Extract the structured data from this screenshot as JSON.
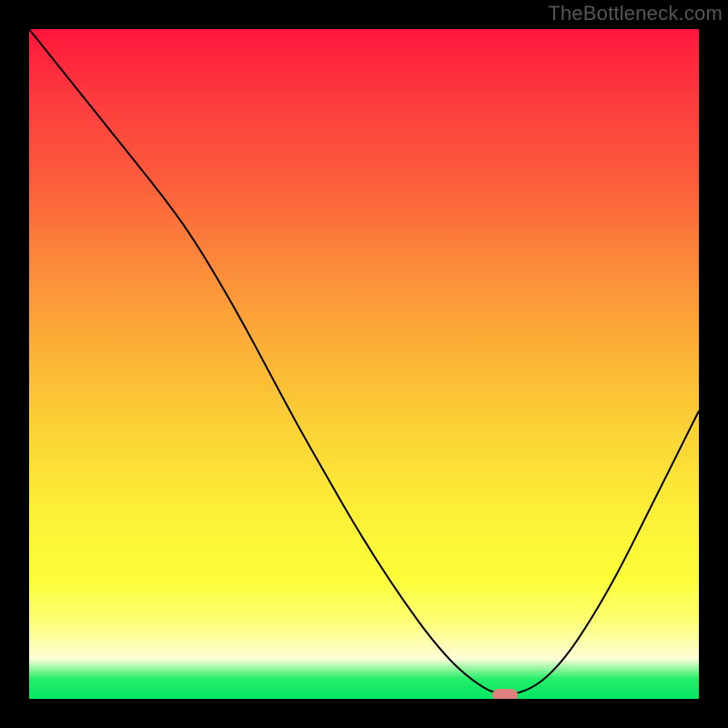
{
  "watermark": "TheBottleneck.com",
  "chart_data": {
    "type": "line",
    "title": "",
    "xlabel": "",
    "ylabel": "",
    "xlim": [
      0,
      100
    ],
    "ylim": [
      0,
      100
    ],
    "x": [
      0,
      4,
      8,
      12,
      16,
      20,
      24,
      28,
      32,
      36,
      40,
      44,
      48,
      52,
      56,
      60,
      64,
      68,
      70,
      72,
      76,
      80,
      84,
      88,
      92,
      96,
      100
    ],
    "values": [
      100,
      95,
      90,
      85,
      80,
      75,
      69.5,
      63,
      56,
      48.5,
      41,
      34,
      27,
      20.5,
      14.5,
      9,
      4.5,
      1.5,
      0.8,
      0.5,
      2,
      6,
      12,
      19,
      27,
      35,
      43
    ],
    "marker": {
      "x": 71,
      "y": 0.5
    },
    "gradient_stops": [
      {
        "pos": 0.0,
        "color": "#fe163b"
      },
      {
        "pos": 0.1,
        "color": "#fd3a3f"
      },
      {
        "pos": 0.22,
        "color": "#fc5b3c"
      },
      {
        "pos": 0.35,
        "color": "#fb893a"
      },
      {
        "pos": 0.48,
        "color": "#fbb237"
      },
      {
        "pos": 0.6,
        "color": "#fbd335"
      },
      {
        "pos": 0.72,
        "color": "#fcef37"
      },
      {
        "pos": 0.78,
        "color": "#fcf938"
      },
      {
        "pos": 0.82,
        "color": "#fcfd38"
      },
      {
        "pos": 0.88,
        "color": "#fdfe6f"
      },
      {
        "pos": 0.94,
        "color": "#fefed9"
      },
      {
        "pos": 0.97,
        "color": "#26ee69"
      },
      {
        "pos": 1.0,
        "color": "#03e763"
      }
    ],
    "marker_color": "#e08081",
    "grid": false,
    "legend": null
  }
}
